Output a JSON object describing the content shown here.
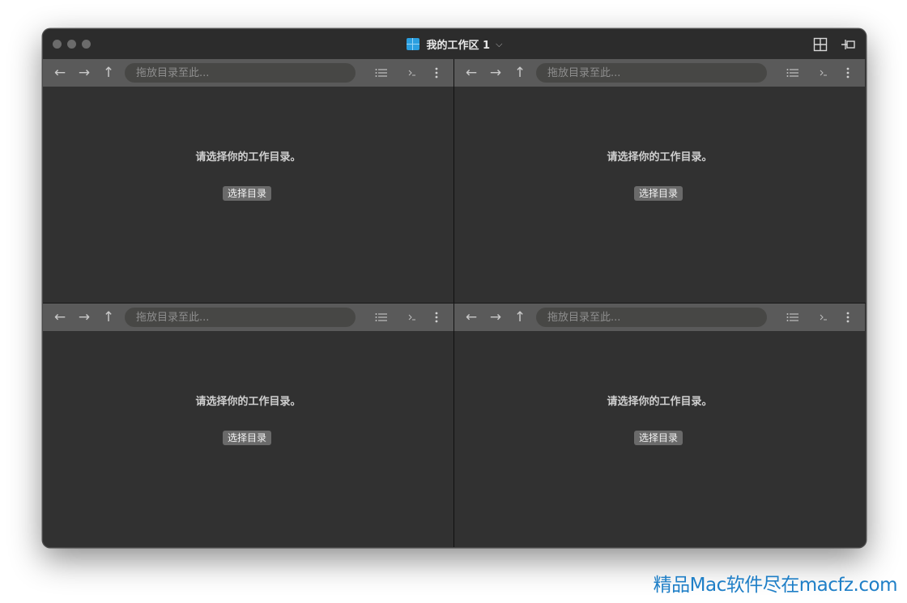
{
  "window": {
    "title": "我的工作区 1",
    "title_chevron": "⌵"
  },
  "panes": [
    {
      "path_placeholder": "拖放目录至此...",
      "prompt": "请选择你的工作目录。",
      "choose_label": "选择目录"
    },
    {
      "path_placeholder": "拖放目录至此...",
      "prompt": "请选择你的工作目录。",
      "choose_label": "选择目录"
    },
    {
      "path_placeholder": "拖放目录至此...",
      "prompt": "请选择你的工作目录。",
      "choose_label": "选择目录"
    },
    {
      "path_placeholder": "拖放目录至此...",
      "prompt": "请选择你的工作目录。",
      "choose_label": "选择目录"
    }
  ],
  "icons": {
    "back": "←",
    "forward": "→",
    "up": "↑",
    "list": "list-icon",
    "terminal": "terminal-icon",
    "more": "more-vertical-icon",
    "layout": "grid-layout-icon",
    "pin": "pin-icon"
  },
  "watermark": "精品Mac软件尽在macfz.com",
  "colors": {
    "window_bg": "#2f2f2f",
    "toolbar_bg": "#5a5a5a",
    "accent": "#2b9fe0",
    "watermark": "#1f7fc7"
  }
}
